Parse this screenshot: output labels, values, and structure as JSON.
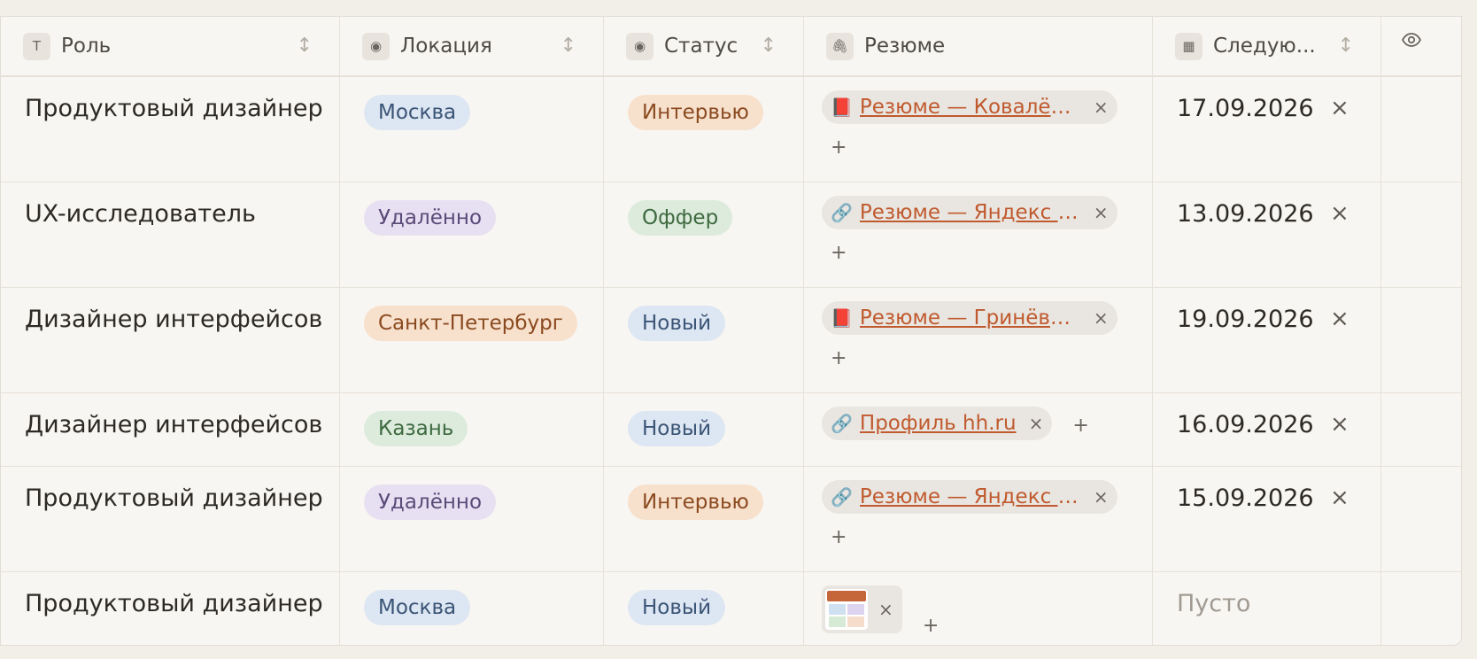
{
  "headers": [
    {
      "label": "Роль",
      "icon": "T"
    },
    {
      "label": "Локация",
      "icon": "◉"
    },
    {
      "label": "Статус",
      "icon": "◉"
    },
    {
      "label": "Резюме",
      "icon": "🖇"
    },
    {
      "label": "Следую...",
      "icon": "▦"
    }
  ],
  "rows": [
    {
      "role": "Продуктовый дизайнер",
      "location": "Москва",
      "status": "Интервью",
      "resume": "Резюме — Ковалёв...",
      "date": "17.09.2026"
    },
    {
      "role": "UX-исследователь",
      "location": "Удалённо",
      "status": "Оффер",
      "resume": "Резюме — Яндекс Д...",
      "date": "13.09.2026"
    },
    {
      "role": "Дизайнер интерфейсов",
      "location": "Санкт-Петербург",
      "status": "Новый",
      "resume": "Резюме — Гринёва....",
      "date": "19.09.2026"
    },
    {
      "role": "Дизайнер интерфейсов",
      "location": "Казань",
      "status": "Новый",
      "resume": "Профиль hh.ru",
      "date": "16.09.2026"
    },
    {
      "role": "Продуктовый дизайнер",
      "location": "Удалённо",
      "status": "Интервью",
      "resume": "Резюме — Яндекс Д...",
      "date": "15.09.2026"
    },
    {
      "role": "Продуктовый дизайнер",
      "location": "Москва",
      "status": "Новый",
      "date_empty": "Пусто"
    }
  ],
  "common": {
    "close": "×",
    "add": "+",
    "sort": "↕"
  }
}
